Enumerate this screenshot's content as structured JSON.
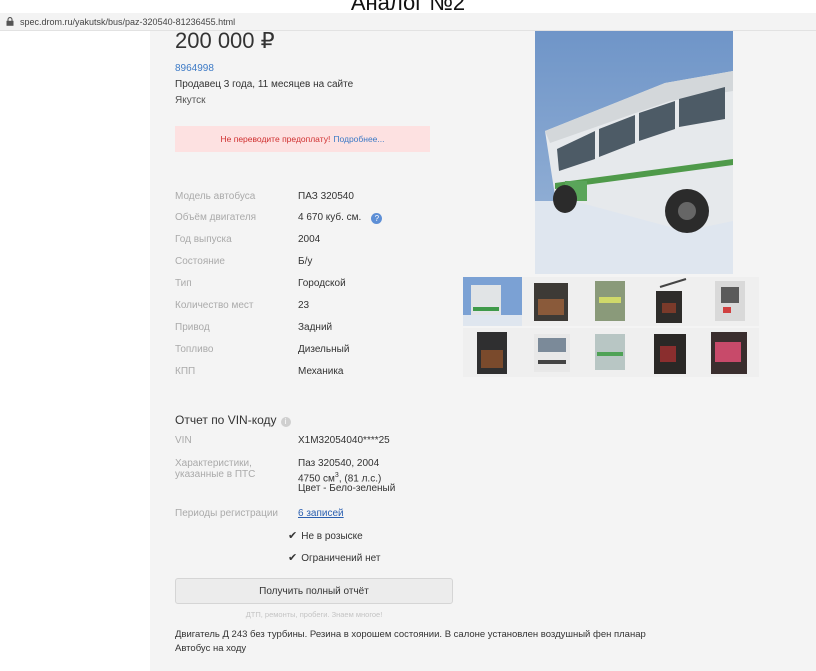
{
  "caption": "Аналог №2",
  "browser": {
    "url": "spec.drom.ru/yakutsk/bus/paz-320540-81236455.html"
  },
  "listing": {
    "price": "200 000 ₽",
    "seller_id": "8964998",
    "seller_age": "Продавец 3 года, 11 месяцев на сайте",
    "city": "Якутск",
    "warning": {
      "text": "Не переводите предоплату!",
      "link": "Подробнее..."
    }
  },
  "specs": [
    {
      "label": "Модель автобуса",
      "value": "ПАЗ 320540"
    },
    {
      "label": "Объём двигателя",
      "value": "4 670 куб. см."
    },
    {
      "label": "Год выпуска",
      "value": "2004"
    },
    {
      "label": "Состояние",
      "value": "Б/у"
    },
    {
      "label": "Тип",
      "value": "Городской"
    },
    {
      "label": "Количество мест",
      "value": "23"
    },
    {
      "label": "Привод",
      "value": "Задний"
    },
    {
      "label": "Топливо",
      "value": "Дизельный"
    },
    {
      "label": "КПП",
      "value": "Механика"
    }
  ],
  "vin_report": {
    "title": "Отчет по VIN-коду",
    "vin_label": "VIN",
    "vin_value": "X1M32054040****25",
    "pts_label_1": "Характеристики,",
    "pts_label_2": "указанные в ПТС",
    "pts_line_1": "Паз 320540, 2004",
    "pts_line_2_prefix": "4750 см",
    "pts_line_2_sup": "3",
    "pts_line_2_suffix": ", (81 л.с.)",
    "pts_line_3": "Цвет - Бело-зеленый",
    "reg_label": "Периоды регистрации",
    "reg_value": "6 записей",
    "check_1": "Не в розыске",
    "check_2": "Ограничений нет",
    "button": "Получить полный отчёт",
    "hint": "ДТП, ремонты, пробеги. Знаем многое!"
  },
  "description": {
    "line_1": "Двигатель Д 243 без турбины. Резина в хорошем состоянии. В салоне установлен воздушный фен планар",
    "line_2": "Автобус на ходу"
  },
  "icons": {
    "lock": "lock-icon",
    "help": "question-icon",
    "info": "info-icon",
    "check": "checkmark-icon"
  },
  "colors": {
    "link": "#3c7ac6",
    "warning_bg": "#fde1e1",
    "warning_text": "#d03030",
    "label": "#aaaaaa"
  }
}
